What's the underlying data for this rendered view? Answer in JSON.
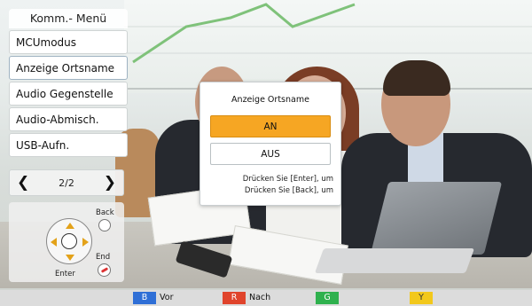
{
  "menu": {
    "title": "Komm.- Menü",
    "items": [
      {
        "label": "MCUmodus"
      },
      {
        "label": "Anzeige Ortsname"
      },
      {
        "label": "Audio Gegenstelle"
      },
      {
        "label": "Audio-Abmisch."
      },
      {
        "label": "USB-Aufn."
      }
    ],
    "pager": {
      "prev_icon": "chevron-left-icon",
      "page": "2/2",
      "next_icon": "chevron-right-icon"
    }
  },
  "remote_hint": {
    "back_label": "Back",
    "end_label": "End",
    "enter_label": "Enter"
  },
  "dialog": {
    "title": "Anzeige Ortsname",
    "options": [
      {
        "label": "AN",
        "selected": true
      },
      {
        "label": "AUS",
        "selected": false
      }
    ],
    "hint_line1": "Drücken Sie [Enter], um",
    "hint_line2": "Drücken Sie [Back], um"
  },
  "keybar": {
    "keys": [
      {
        "key": "B",
        "label": "Vor",
        "color": "#2f6fd6"
      },
      {
        "key": "R",
        "label": "Nach",
        "color": "#e0442c"
      },
      {
        "key": "G",
        "label": "",
        "color": "#2fb14e"
      },
      {
        "key": "Y",
        "label": "",
        "color": "#f2c81c"
      }
    ]
  },
  "colors": {
    "selected_option": "#f6a623",
    "dpad_arrows": "#e3a21a"
  }
}
